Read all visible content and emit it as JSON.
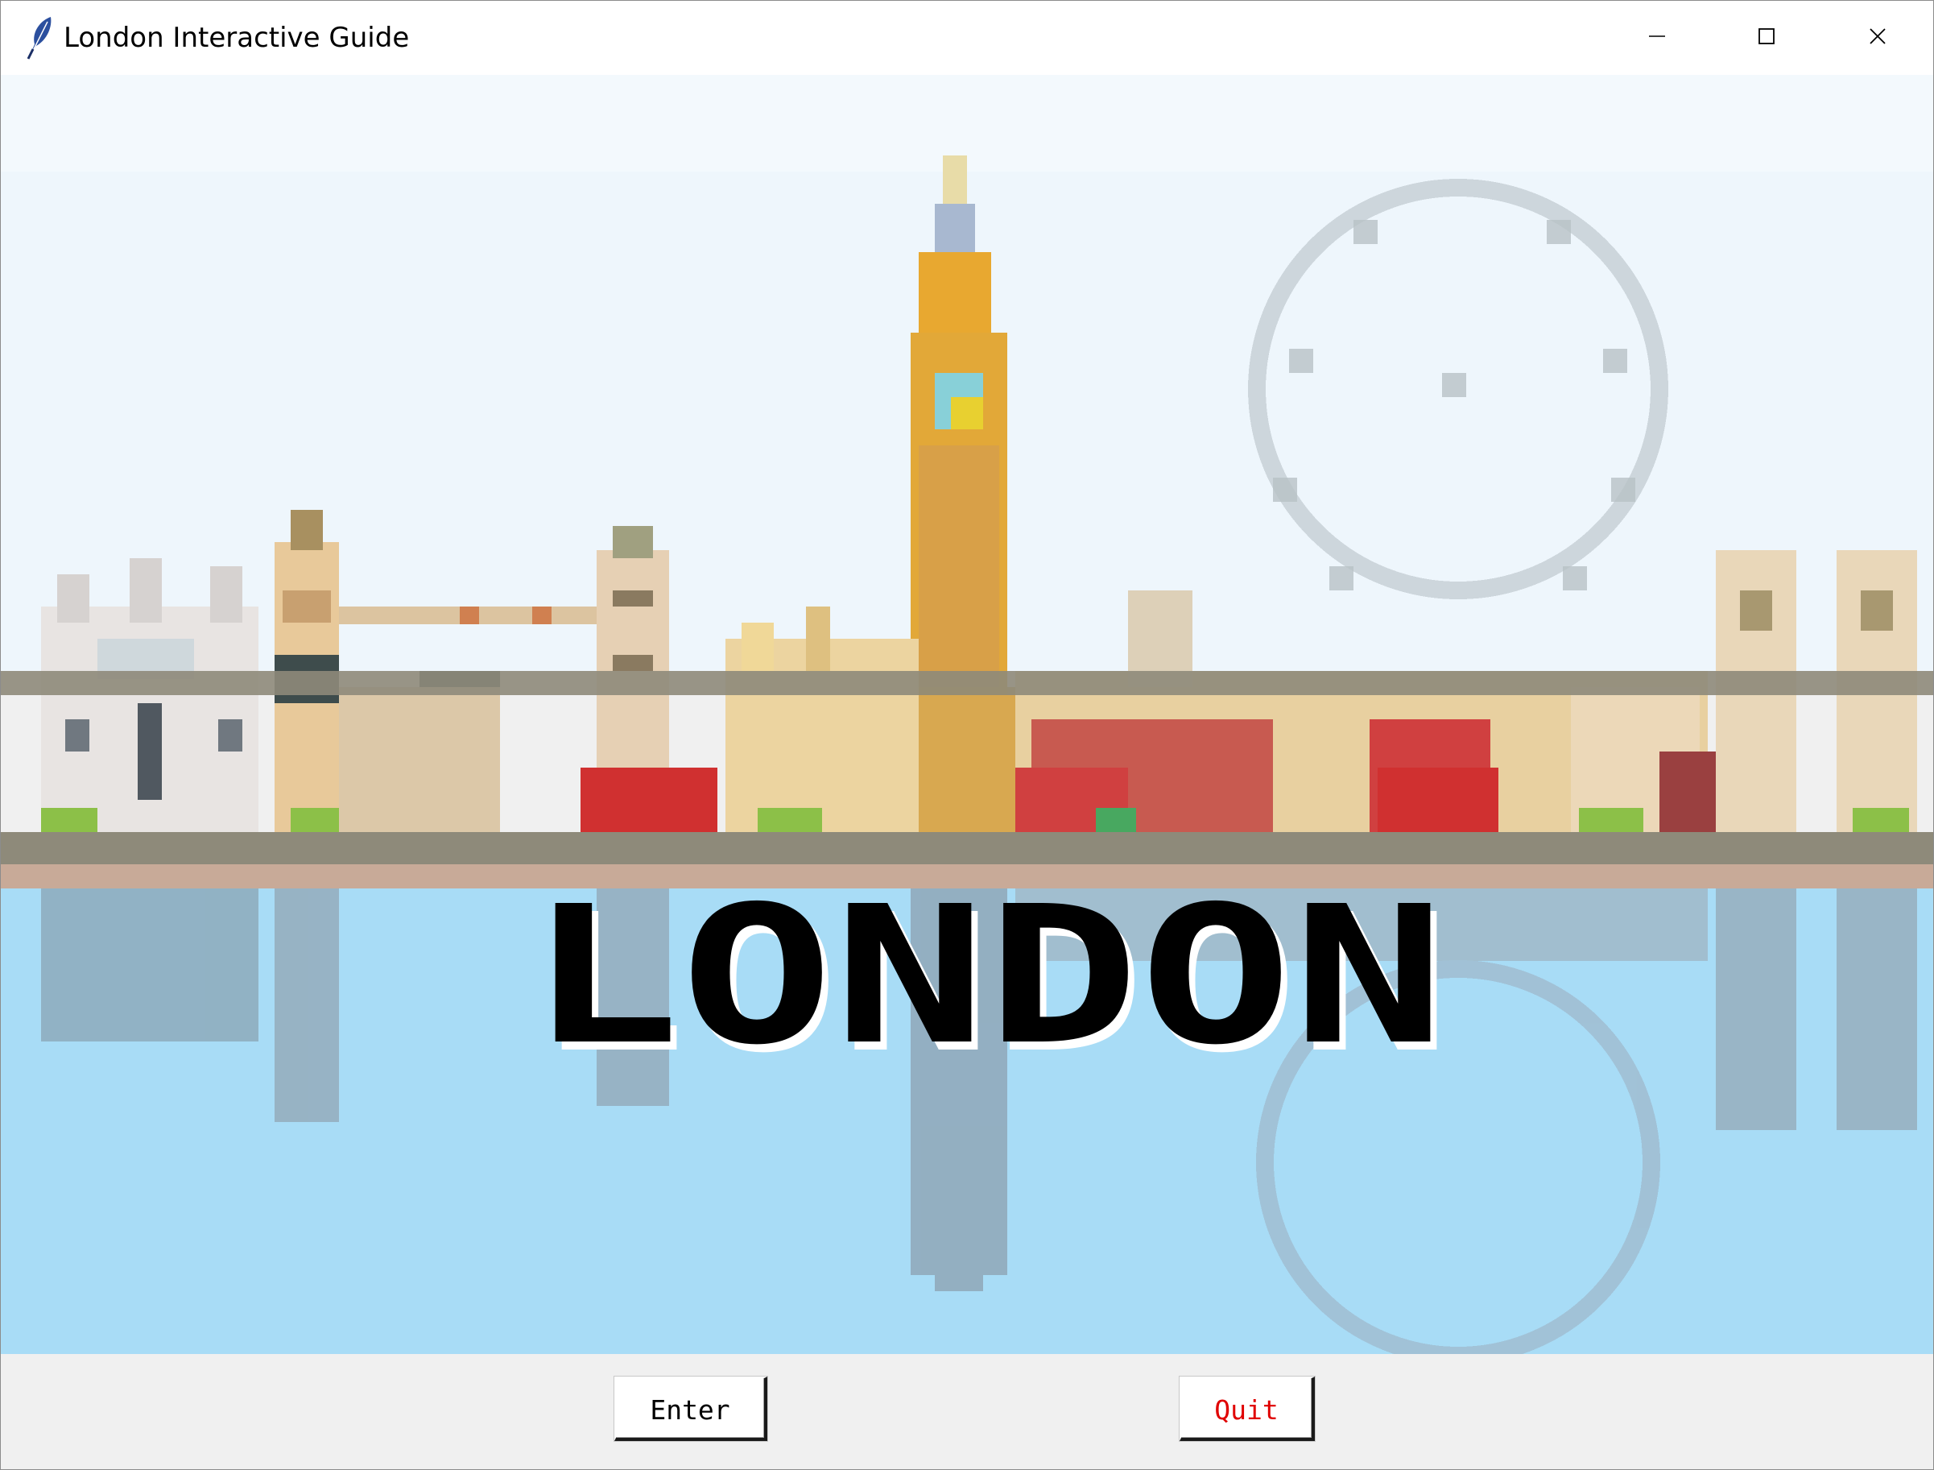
{
  "window": {
    "title": "London Interactive Guide",
    "icon": "feather-icon",
    "controls": [
      "minimize-icon",
      "maximize-icon",
      "close-icon"
    ]
  },
  "scene": {
    "logo_text": "LONDON",
    "sky_color": "#eef6fc",
    "water_color": "#a8dcf6",
    "embankment_color": "#8e8a7a"
  },
  "buttons": {
    "enter_label": "Enter",
    "quit_label": "Quit",
    "quit_color": "#e00000"
  }
}
